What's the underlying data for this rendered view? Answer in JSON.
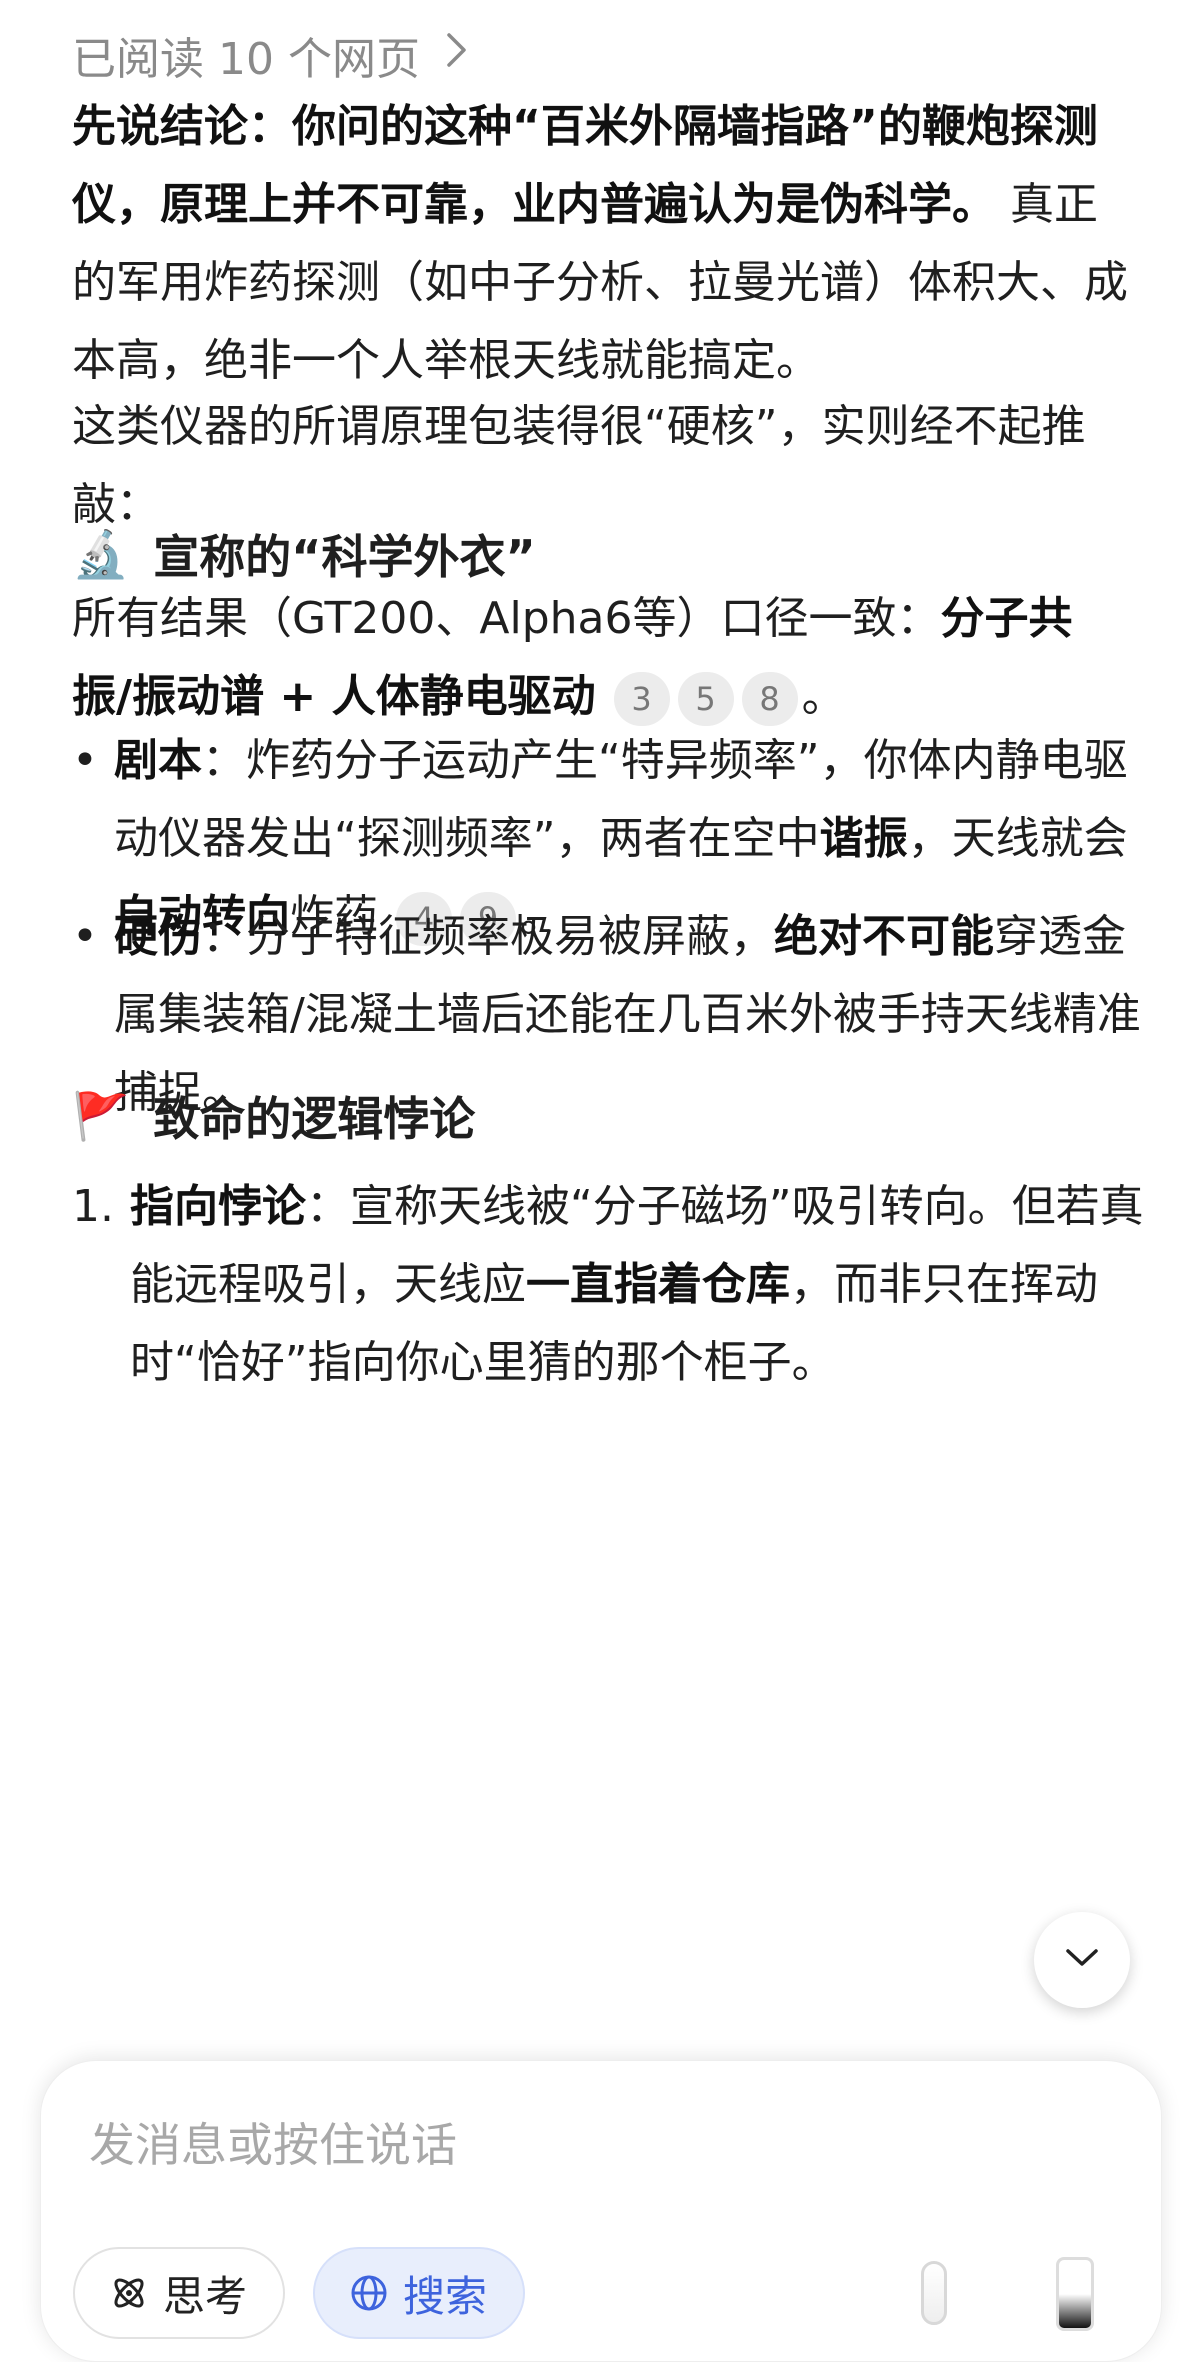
{
  "header": {
    "read_label": "已阅读 10 个网页"
  },
  "p1": {
    "bold": "先说结论：你问的这种“百米外隔墙指路”的鞭炮探测仪，原理上并不可靠，业内普遍认为是伪科学。",
    "rest": " 真正的军用炸药探测（如中子分析、拉曼光谱）体积大、成本高，绝非一个人举根天线就能搞定。"
  },
  "p2": {
    "text": "这类仪器的所谓原理包装得很“硬核”，实则经不起推敲："
  },
  "section1": {
    "emoji": "🔬",
    "title": "宣称的“科学外衣”",
    "intro_prefix": "所有结果（GT200、Alpha6等）口径一致：",
    "intro_bold": "分子共振/振动谱 + 人体静电驱动",
    "intro_cites": [
      "3",
      "5",
      "8"
    ],
    "intro_end": "。"
  },
  "bullets": [
    {
      "label": "剧本",
      "a": "：炸药分子运动产生“特异频率”，你体内静电驱动仪器发出“探测频率”，两者在空中",
      "b1": "谐振",
      "c": "，天线就会",
      "b2": "自动转向",
      "d": "炸药",
      "cites": [
        "4",
        "9"
      ],
      "end": "。"
    },
    {
      "label": "硬伤",
      "a": "：分子特征频率极易被屏蔽，",
      "b1": "绝对不可能",
      "c": "穿透金属集装箱/混凝土墙后还能在几百米外被手持天线精准捕捉。"
    }
  ],
  "section2": {
    "emoji": "🚩",
    "title": "致命的逻辑悖论"
  },
  "numbered": [
    {
      "num": "1.",
      "label": "指向悖论",
      "a": "：宣称天线被“分子磁场”吸引转向。但若真能远程吸引，天线应",
      "b1": "一直指着仓库",
      "c": "，而非只在挥动时“恰好”指向你心里猜的那个柜子。"
    }
  ],
  "composer": {
    "placeholder": "发消息或按住说话",
    "think_label": "思考",
    "search_label": "搜索"
  }
}
